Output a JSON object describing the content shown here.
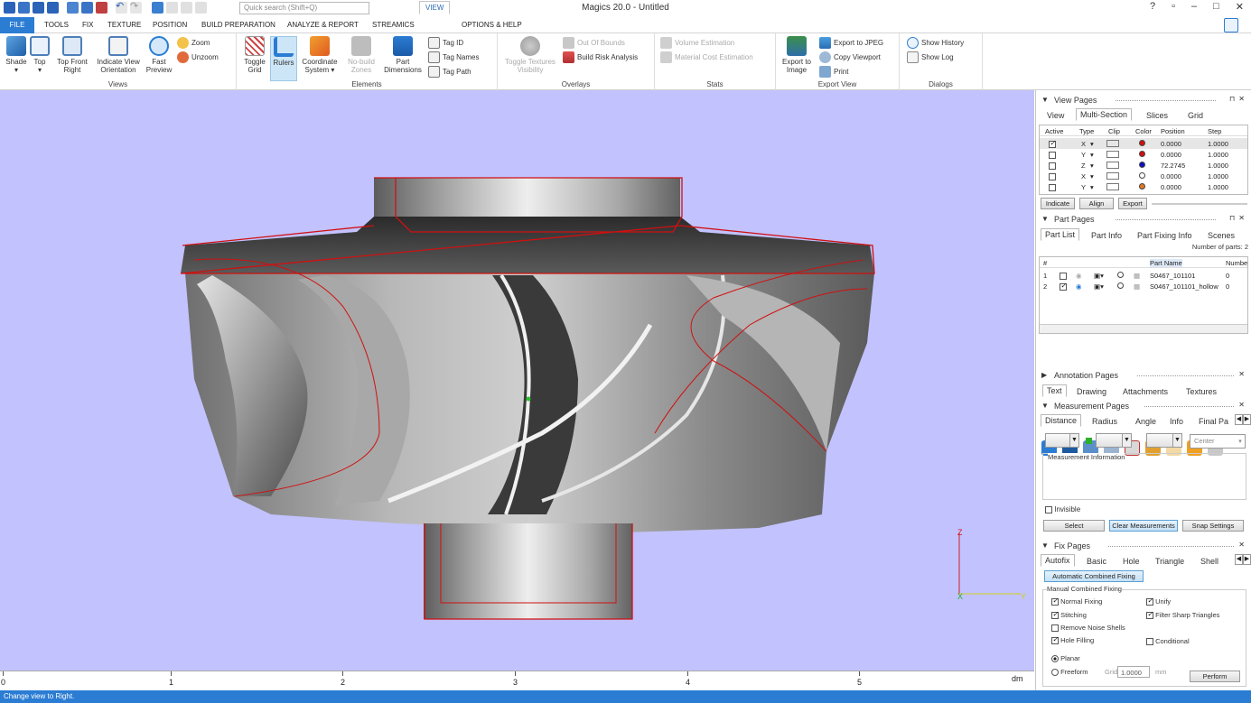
{
  "app": {
    "title": "Magics 20.0 - Untitled",
    "search_placeholder": "Quick search (Shift+Q)"
  },
  "menu": {
    "tabs": [
      "FILE",
      "TOOLS",
      "FIX",
      "TEXTURE",
      "POSITION",
      "BUILD PREPARATION",
      "ANALYZE & REPORT",
      "STREAMICS",
      "VIEW",
      "OPTIONS & HELP"
    ],
    "active": "VIEW"
  },
  "ribbon": {
    "views": {
      "label": "Views",
      "shade": "Shade",
      "top": "Top",
      "top_front_right": "Top Front Right",
      "indicate_view": "Indicate View Orientation",
      "fast_preview": "Fast Preview",
      "zoom": "Zoom",
      "unzoom": "Unzoom"
    },
    "elements": {
      "label": "Elements",
      "toggle_grid": "Toggle Grid",
      "rulers": "Rulers",
      "coordinate_system": "Coordinate System",
      "no_build_zones": "No-build Zones",
      "part_dimensions": "Part Dimensions",
      "tag_id": "Tag ID",
      "tag_names": "Tag Names",
      "tag_path": "Tag Path"
    },
    "overlays": {
      "label": "Overlays",
      "toggle_textures": "Toggle Textures Visibility",
      "out_of_bounds": "Out Of Bounds",
      "build_risk": "Build Risk Analysis"
    },
    "stats": {
      "label": "Stats",
      "volume": "Volume Estimation",
      "material_cost": "Material Cost Estimation"
    },
    "export_view": {
      "label": "Export View",
      "export_image": "Export to Image",
      "export_jpeg": "Export to JPEG",
      "copy_viewport": "Copy Viewport",
      "print": "Print"
    },
    "dialogs": {
      "label": "Dialogs",
      "show_history": "Show History",
      "show_log": "Show Log"
    }
  },
  "ruler": {
    "ticks": [
      "0",
      "1",
      "2",
      "3",
      "4",
      "5"
    ],
    "unit": "dm"
  },
  "axes": {
    "z": "Z",
    "x": "X",
    "y": "Y"
  },
  "status": "Change view to Right.",
  "view_pages": {
    "title": "View Pages",
    "tabs": [
      "View",
      "Multi-Section",
      "Slices",
      "Grid"
    ],
    "active_tab": "Multi-Section",
    "columns": [
      "Active",
      "Type",
      "Clip",
      "Color",
      "Position",
      "Step"
    ],
    "rows": [
      {
        "active": true,
        "type": "X",
        "color": "#d01010",
        "position": "0.0000",
        "step": "1.0000"
      },
      {
        "active": false,
        "type": "Y",
        "color": "#d01010",
        "position": "0.0000",
        "step": "1.0000"
      },
      {
        "active": false,
        "type": "Z",
        "color": "#1010c0",
        "position": "72.2745",
        "step": "1.0000"
      },
      {
        "active": false,
        "type": "X",
        "color": "#ffffff",
        "position": "0.0000",
        "step": "1.0000"
      },
      {
        "active": false,
        "type": "Y",
        "color": "#e07820",
        "position": "0.0000",
        "step": "1.0000"
      }
    ],
    "buttons": [
      "Indicate",
      "Align",
      "Export"
    ]
  },
  "part_pages": {
    "title": "Part Pages",
    "tabs": [
      "Part List",
      "Part Info",
      "Part Fixing Info",
      "Scenes"
    ],
    "active_tab": "Part List",
    "num_parts": "Number of parts: 2",
    "columns": [
      "#",
      "Part Name",
      "Numbe"
    ],
    "rows": [
      {
        "index": "1",
        "checked": false,
        "name": "S0467_101101",
        "num": "0"
      },
      {
        "index": "2",
        "checked": true,
        "name": "S0467_101101_hollow",
        "num": "0"
      }
    ]
  },
  "annotation_pages": {
    "title": "Annotation Pages",
    "tabs": [
      "Text",
      "Drawing",
      "Attachments",
      "Textures"
    ],
    "active_tab": "Text"
  },
  "measurement_pages": {
    "title": "Measurement Pages",
    "tabs": [
      "Distance",
      "Radius",
      "Angle",
      "Info",
      "Final Pa"
    ],
    "active_tab": "Distance",
    "snap": "Center",
    "info_label": "Measurement Information",
    "invisible": "Invisible",
    "buttons": [
      "Select",
      "Clear Measurements",
      "Snap Settings"
    ]
  },
  "fix_pages": {
    "title": "Fix Pages",
    "tabs": [
      "Autofix",
      "Basic",
      "Hole",
      "Triangle",
      "Shell"
    ],
    "active_tab": "Autofix",
    "auto_button": "Automatic Combined Fixing",
    "manual_label": "Manual Combined Fixing",
    "options_left": [
      {
        "label": "Normal Fixing",
        "checked": true
      },
      {
        "label": "Stitching",
        "checked": true
      },
      {
        "label": "Remove Noise Shells",
        "checked": false
      },
      {
        "label": "Hole Filling",
        "checked": true
      }
    ],
    "options_right": [
      {
        "label": "Unify",
        "checked": true
      },
      {
        "label": "Filter Sharp Triangles",
        "checked": true
      },
      {
        "label": "Conditional",
        "checked": false
      }
    ],
    "planar": "Planar",
    "freeform": "Freeform",
    "grid_label": "Grid",
    "grid_value": "1.0000",
    "grid_unit": "mm",
    "perform": "Perform"
  }
}
